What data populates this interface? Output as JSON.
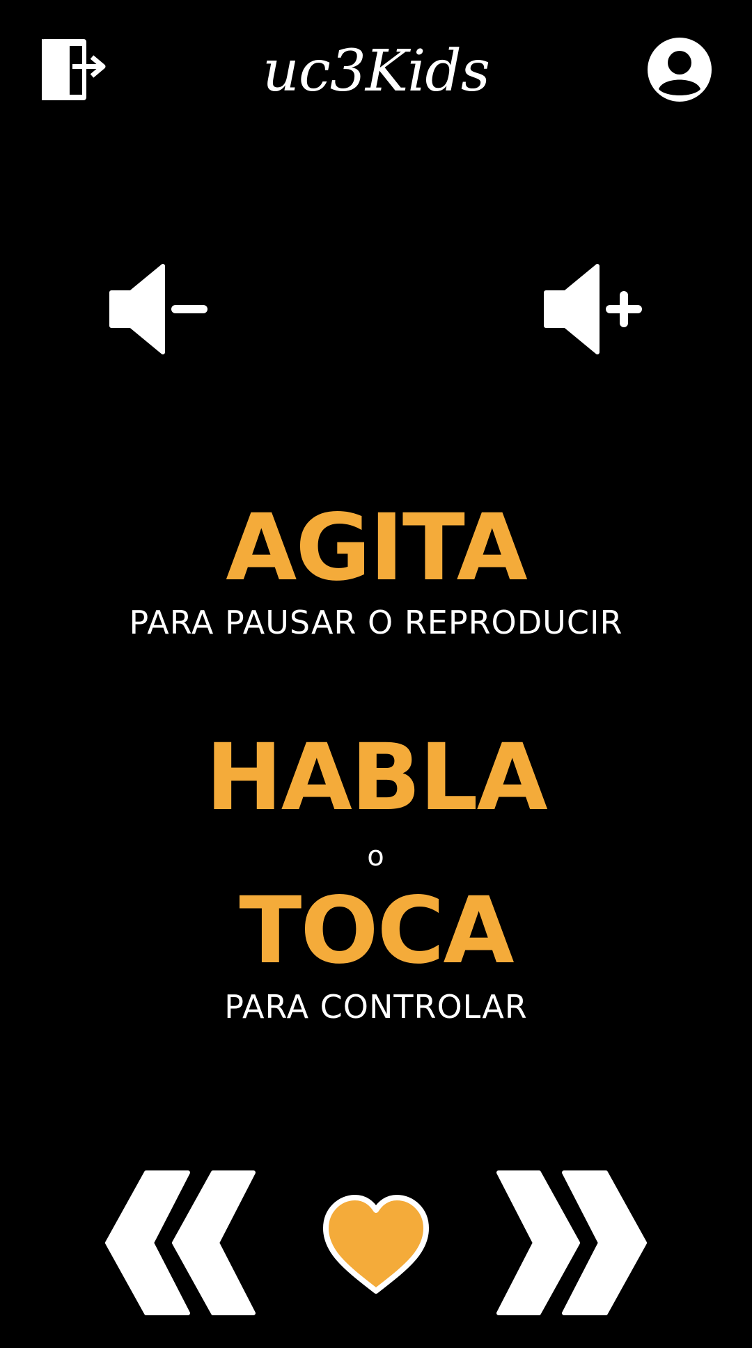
{
  "header": {
    "brand": "uc3Kids",
    "exit_icon": "exit-door-icon",
    "profile_icon": "user-profile-icon"
  },
  "volume": {
    "down_icon": "volume-down-icon",
    "up_icon": "volume-up-icon"
  },
  "instructions": {
    "shake_word": "AGITA",
    "shake_desc": "PARA PAUSAR O REPRODUCIR",
    "speak_word": "HABLA",
    "separator": "o",
    "touch_word": "TOCA",
    "touch_desc": "PARA CONTROLAR"
  },
  "controls": {
    "previous_icon": "double-chevron-left-icon",
    "favorite_icon": "heart-icon",
    "next_icon": "double-chevron-right-icon"
  },
  "colors": {
    "background": "#000000",
    "accent": "#f4ab3a",
    "foreground": "#ffffff"
  }
}
